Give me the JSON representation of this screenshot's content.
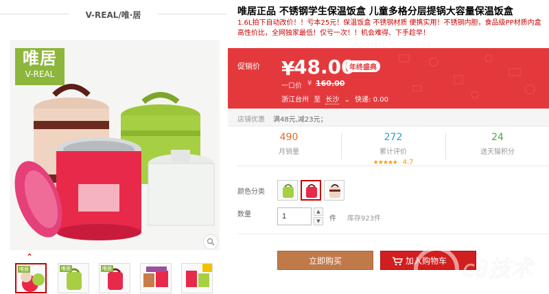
{
  "brand": {
    "name": "V-REAL/唯·居",
    "logo_cn": "唯居",
    "logo_en": "V-REAL"
  },
  "product": {
    "title": "唯居正品 不锈钢学生保温饭盒 儿童多格分层提锅大容量保温饭盒",
    "subtitle": "1.6L拍下自动改价！！亏本25元！保温饭盒 不锈钢材质 便携实用！不锈钢内胆，食品级PP材质内盒 高性价比，全网独家最低！仅亏一次！！机会难得、下手趁早！"
  },
  "pricing": {
    "label": "促销价",
    "currency": "¥",
    "price": "48.00",
    "badge": "年终盛典",
    "original_label": "一口价",
    "original_currency": "¥",
    "original_price": "160.00",
    "ship_from": "浙江台州",
    "ship_to_word": "至",
    "ship_to": "长沙",
    "ship_fee_label": "快递: 0.00"
  },
  "promo": {
    "label": "店铺优惠",
    "value": "满48元,减23元；"
  },
  "stats": {
    "monthly_sales": "490",
    "monthly_sales_label": "月销量",
    "reviews": "272",
    "reviews_label": "累计评价",
    "rating": "4.7",
    "stars": "★★★★★",
    "points": "24",
    "points_label": "送天猫积分"
  },
  "options": {
    "color_label": "颜色分类",
    "qty_label": "数量",
    "qty_value": "1",
    "qty_unit": "件",
    "stock": "库存923件"
  },
  "actions": {
    "buy_now": "立即购买",
    "add_to_cart": "加入购物车"
  },
  "thumbnails": {
    "thumb_tag": "唯居",
    "count": 5
  },
  "watermark": "c8技术",
  "colors": {
    "accent_red": "#e4393c",
    "buy_button": "#c07a4a",
    "cart_button": "#d21e1e"
  }
}
